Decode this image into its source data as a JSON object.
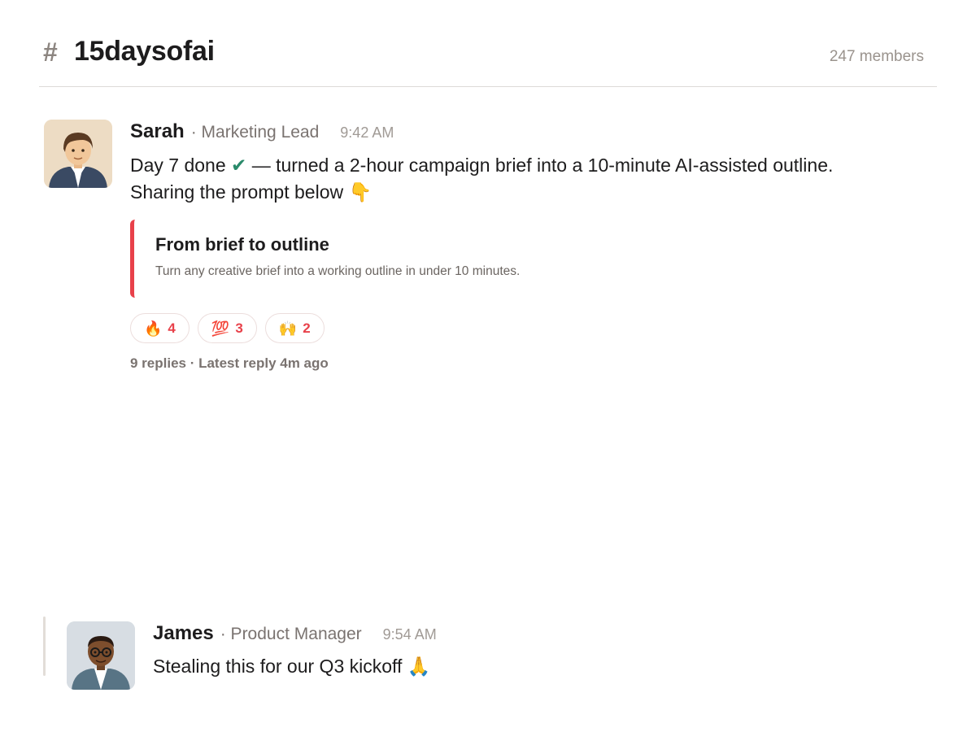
{
  "channel": {
    "hash": "#",
    "name": "15daysofai",
    "members": "247 members"
  },
  "message": {
    "author": "Sarah",
    "role": "· Marketing Lead",
    "time": "9:42 AM",
    "avatar_icon": "person-avatar-icon",
    "text_before_check": "Day 7 done ",
    "check": "✔",
    "text_after_check": " — turned a 2-hour campaign brief into a 10-minute AI-assisted outline.",
    "line2": "Sharing the prompt below 👇",
    "card": {
      "title": "From brief to outline",
      "description": "Turn any creative brief into a working outline in under 10 minutes."
    },
    "reactions": [
      {
        "emoji": "🔥",
        "count": "4"
      },
      {
        "emoji": "💯",
        "count": "3"
      },
      {
        "emoji": "🙌",
        "count": "2"
      }
    ],
    "thread": "9 replies · Latest reply 4m ago"
  },
  "reply": {
    "author": "James",
    "role": "· Product Manager",
    "time": "9:54 AM",
    "avatar_icon": "person-avatar-icon",
    "text": "Stealing this for our Q3 kickoff 🙏"
  },
  "colors": {
    "accent": "#e8414a",
    "muted": "#7a7370",
    "check": "#2a8a6a"
  }
}
